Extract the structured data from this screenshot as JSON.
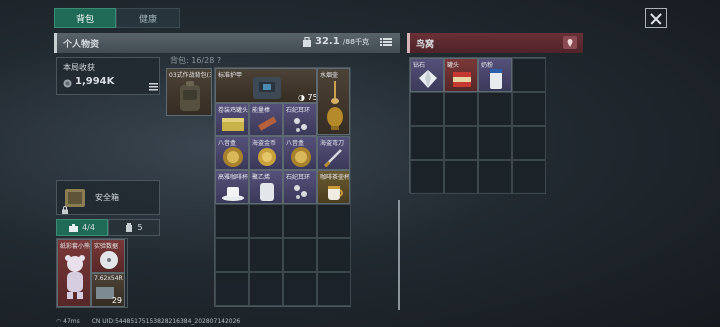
{
  "tabs": [
    {
      "label": "背包",
      "active": true
    },
    {
      "label": "健康",
      "active": false
    }
  ],
  "personal": {
    "title": "个人物资",
    "weight_current": "32.1",
    "weight_max": "/88千克"
  },
  "nest": {
    "title": "鸟窝"
  },
  "earnings": {
    "label": "本局收获",
    "value": "1,994K"
  },
  "backpack_capacity": "背包: 16/28 ?",
  "safebox": {
    "label": "安全箱"
  },
  "tab_counts": {
    "a": "4/4",
    "b": "5"
  },
  "backpack_items": [
    {
      "name": "03式作战背包(三角)",
      "color": "purple"
    },
    {
      "name": "标准护甲",
      "color": "dark",
      "badge": "75"
    },
    {
      "name": "水烟壶",
      "color": "dark"
    },
    {
      "name": "卷装鸡罐头",
      "color": "purple"
    },
    {
      "name": "能量棒",
      "color": "purple"
    },
    {
      "name": "石纪耳环",
      "color": "purple"
    },
    {
      "name": "八音盒",
      "color": "purple"
    },
    {
      "name": "海盗金币",
      "color": "purple"
    },
    {
      "name": "八音盒",
      "color": "purple"
    },
    {
      "name": "海盗弯刀",
      "color": "purple"
    },
    {
      "name": "高雅咖啡杯",
      "color": "purple"
    },
    {
      "name": "聚乙烯",
      "color": "purple"
    },
    {
      "name": "石纪耳环",
      "color": "purple"
    },
    {
      "name": "咖啡茶壶杯",
      "color": "gold"
    }
  ],
  "nest_items": [
    {
      "name": "钻石",
      "color": "purple"
    },
    {
      "name": "罐头",
      "color": "red"
    },
    {
      "name": "奶粉",
      "color": "purple"
    }
  ],
  "quick_items": [
    {
      "name": "纸彩套小熊",
      "color": "red"
    },
    {
      "name": "实验数据",
      "color": "red"
    },
    {
      "name": "7.62x54R",
      "color": "dark",
      "count": "29"
    }
  ],
  "status": {
    "ping": "47ms",
    "uid": "CN UID:54485175153828216384_202807142026"
  },
  "colors": {
    "tab_active": "#1f6b57",
    "nest_header": "#6a3037",
    "gold": "#b58a2a"
  }
}
